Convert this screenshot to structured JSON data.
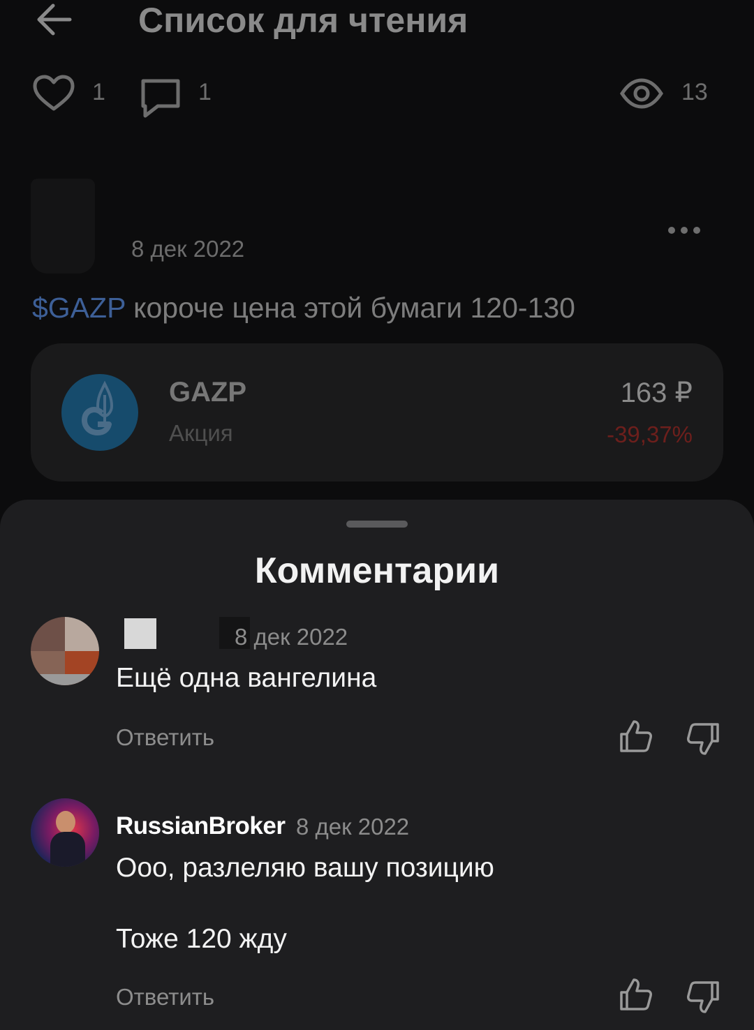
{
  "header": {
    "title": "Список для чтения"
  },
  "stats": {
    "likes": "1",
    "comments": "1",
    "views": "13"
  },
  "post": {
    "date": "8 дек 2022",
    "ticker": "$GAZP",
    "text": " короче цена этой бумаги 120-130"
  },
  "instrument": {
    "ticker": "GAZP",
    "type": "Акция",
    "price": "163 ₽",
    "change": "-39,37%",
    "change_color": "#6d1f1c"
  },
  "comments_sheet": {
    "title": "Комментарии",
    "items": [
      {
        "author": "",
        "date": "8 дек 2022",
        "text": "Ещё одна вангелина",
        "reply_label": "Ответить"
      },
      {
        "author": "RussianBroker",
        "date": "8 дек 2022",
        "text_line1": "Ооо, разлеляю вашу позицию",
        "text_line2": "Тоже 120 жду",
        "reply_label": "Ответить"
      }
    ]
  },
  "icons": [
    "back-arrow-icon",
    "heart-icon",
    "comment-icon",
    "eye-icon",
    "more-dots-icon",
    "gazprom-logo",
    "thumbs-up-icon",
    "thumbs-down-icon"
  ]
}
